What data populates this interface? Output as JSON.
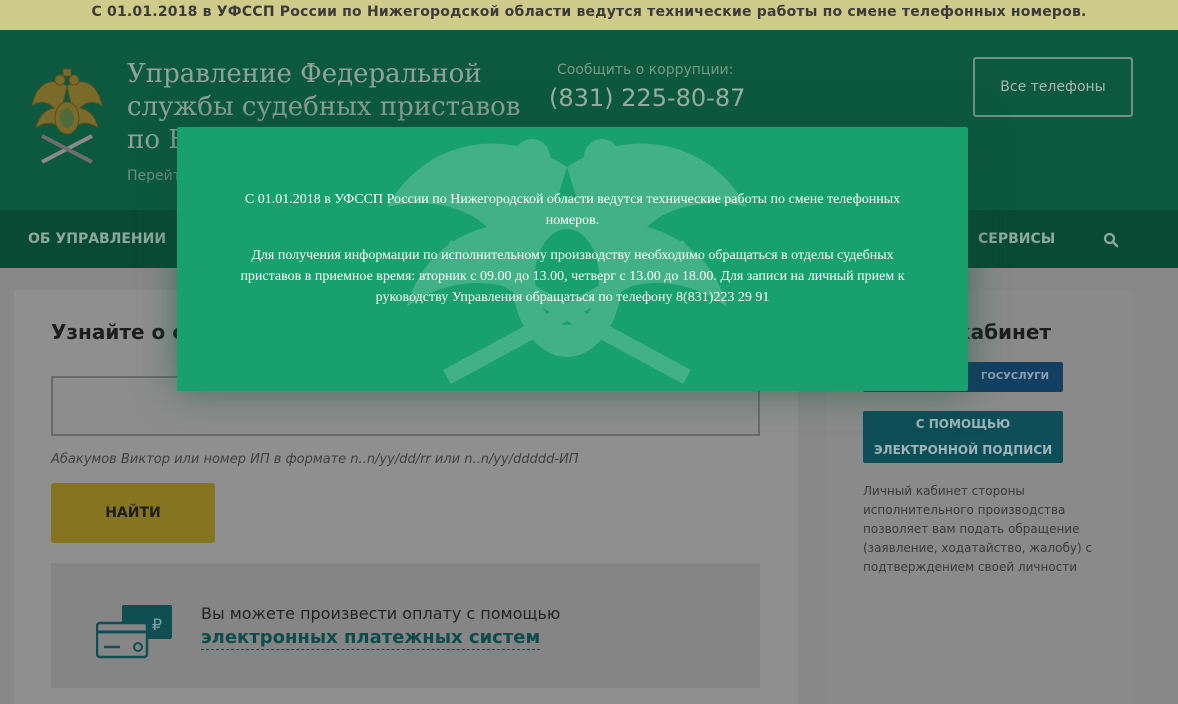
{
  "notice_bar": {
    "text": "С 01.01.2018 в УФССП России по Нижегородской области ведутся технические работы по смене телефонных номеров."
  },
  "header": {
    "org_name_lines": [
      "Управление Федеральной",
      "службы судебных приставов",
      "по Н"
    ],
    "org_subtext": "Перейт",
    "corruption_label": "Сообщить о коррупции:",
    "corruption_phone": "(831) 225-80-87",
    "all_phones_button": "Все телефоны"
  },
  "nav": {
    "items": [
      "ОБ УПРАВЛЕНИИ",
      "СЕРВИСЫ"
    ],
    "search_icon": "search-icon"
  },
  "main": {
    "find_title": "Узнайте о с",
    "search_input_value": "",
    "search_hint": "Абакумов Виктор или номер ИП в формате n..n/yy/dd/rr или n..n/yy/ddddd-ИП",
    "find_button": "НАЙТИ",
    "payment_text": "Вы можете произвести оплату с помощью",
    "payment_link": "электронных платежных систем",
    "payment_icon": "card-ruble-icon"
  },
  "sidebar": {
    "title": "кабинет",
    "gosuslugi_button": "ГОСУСЛУГИ",
    "signature_button_lines": [
      "С ПОМОЩЬЮ",
      "ЭЛЕКТРОННОЙ ПОДПИСИ"
    ],
    "description": "Личный кабинет стороны исполнительного производства позволяет вам подать обращение (заявление, ходатайство, жалобу) с подтверждением своей личности"
  },
  "modal": {
    "paragraph_1": "С 01.01.2018 в УФССП России по Нижегородской области ведутся технические работы по смене телефонных номеров.",
    "paragraph_2": "Для получения информации по исполнительному производству необходимо обращаться в отделы судебных приставов в приемное время: вторник с 09.00 до 13.00, четверг с 13.00 до 18.00. Для записи на личный прием к руководству Управления обращаться по телефону 8(831)223 29 91"
  },
  "colors": {
    "header_bg": "#0d5940",
    "nav_bg": "#094a35",
    "modal_bg": "#18a06e",
    "find_button_bg": "#867520",
    "notice_bg": "#cfcc8b"
  }
}
